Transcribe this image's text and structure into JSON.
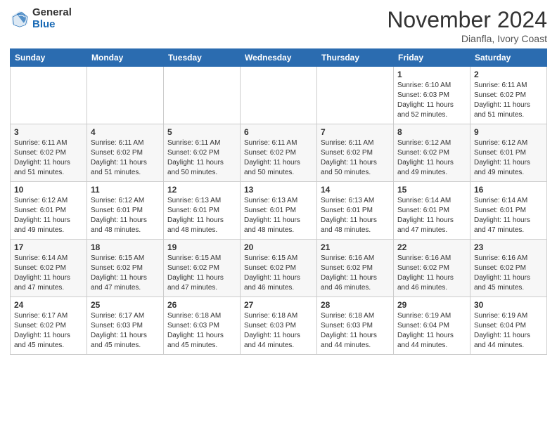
{
  "logo": {
    "general": "General",
    "blue": "Blue"
  },
  "header": {
    "month": "November 2024",
    "location": "Dianfla, Ivory Coast"
  },
  "weekdays": [
    "Sunday",
    "Monday",
    "Tuesday",
    "Wednesday",
    "Thursday",
    "Friday",
    "Saturday"
  ],
  "weeks": [
    [
      {
        "day": "",
        "info": ""
      },
      {
        "day": "",
        "info": ""
      },
      {
        "day": "",
        "info": ""
      },
      {
        "day": "",
        "info": ""
      },
      {
        "day": "",
        "info": ""
      },
      {
        "day": "1",
        "info": "Sunrise: 6:10 AM\nSunset: 6:03 PM\nDaylight: 11 hours and 52 minutes."
      },
      {
        "day": "2",
        "info": "Sunrise: 6:11 AM\nSunset: 6:02 PM\nDaylight: 11 hours and 51 minutes."
      }
    ],
    [
      {
        "day": "3",
        "info": "Sunrise: 6:11 AM\nSunset: 6:02 PM\nDaylight: 11 hours and 51 minutes."
      },
      {
        "day": "4",
        "info": "Sunrise: 6:11 AM\nSunset: 6:02 PM\nDaylight: 11 hours and 51 minutes."
      },
      {
        "day": "5",
        "info": "Sunrise: 6:11 AM\nSunset: 6:02 PM\nDaylight: 11 hours and 50 minutes."
      },
      {
        "day": "6",
        "info": "Sunrise: 6:11 AM\nSunset: 6:02 PM\nDaylight: 11 hours and 50 minutes."
      },
      {
        "day": "7",
        "info": "Sunrise: 6:11 AM\nSunset: 6:02 PM\nDaylight: 11 hours and 50 minutes."
      },
      {
        "day": "8",
        "info": "Sunrise: 6:12 AM\nSunset: 6:02 PM\nDaylight: 11 hours and 49 minutes."
      },
      {
        "day": "9",
        "info": "Sunrise: 6:12 AM\nSunset: 6:01 PM\nDaylight: 11 hours and 49 minutes."
      }
    ],
    [
      {
        "day": "10",
        "info": "Sunrise: 6:12 AM\nSunset: 6:01 PM\nDaylight: 11 hours and 49 minutes."
      },
      {
        "day": "11",
        "info": "Sunrise: 6:12 AM\nSunset: 6:01 PM\nDaylight: 11 hours and 48 minutes."
      },
      {
        "day": "12",
        "info": "Sunrise: 6:13 AM\nSunset: 6:01 PM\nDaylight: 11 hours and 48 minutes."
      },
      {
        "day": "13",
        "info": "Sunrise: 6:13 AM\nSunset: 6:01 PM\nDaylight: 11 hours and 48 minutes."
      },
      {
        "day": "14",
        "info": "Sunrise: 6:13 AM\nSunset: 6:01 PM\nDaylight: 11 hours and 48 minutes."
      },
      {
        "day": "15",
        "info": "Sunrise: 6:14 AM\nSunset: 6:01 PM\nDaylight: 11 hours and 47 minutes."
      },
      {
        "day": "16",
        "info": "Sunrise: 6:14 AM\nSunset: 6:01 PM\nDaylight: 11 hours and 47 minutes."
      }
    ],
    [
      {
        "day": "17",
        "info": "Sunrise: 6:14 AM\nSunset: 6:02 PM\nDaylight: 11 hours and 47 minutes."
      },
      {
        "day": "18",
        "info": "Sunrise: 6:15 AM\nSunset: 6:02 PM\nDaylight: 11 hours and 47 minutes."
      },
      {
        "day": "19",
        "info": "Sunrise: 6:15 AM\nSunset: 6:02 PM\nDaylight: 11 hours and 47 minutes."
      },
      {
        "day": "20",
        "info": "Sunrise: 6:15 AM\nSunset: 6:02 PM\nDaylight: 11 hours and 46 minutes."
      },
      {
        "day": "21",
        "info": "Sunrise: 6:16 AM\nSunset: 6:02 PM\nDaylight: 11 hours and 46 minutes."
      },
      {
        "day": "22",
        "info": "Sunrise: 6:16 AM\nSunset: 6:02 PM\nDaylight: 11 hours and 46 minutes."
      },
      {
        "day": "23",
        "info": "Sunrise: 6:16 AM\nSunset: 6:02 PM\nDaylight: 11 hours and 45 minutes."
      }
    ],
    [
      {
        "day": "24",
        "info": "Sunrise: 6:17 AM\nSunset: 6:02 PM\nDaylight: 11 hours and 45 minutes."
      },
      {
        "day": "25",
        "info": "Sunrise: 6:17 AM\nSunset: 6:03 PM\nDaylight: 11 hours and 45 minutes."
      },
      {
        "day": "26",
        "info": "Sunrise: 6:18 AM\nSunset: 6:03 PM\nDaylight: 11 hours and 45 minutes."
      },
      {
        "day": "27",
        "info": "Sunrise: 6:18 AM\nSunset: 6:03 PM\nDaylight: 11 hours and 44 minutes."
      },
      {
        "day": "28",
        "info": "Sunrise: 6:18 AM\nSunset: 6:03 PM\nDaylight: 11 hours and 44 minutes."
      },
      {
        "day": "29",
        "info": "Sunrise: 6:19 AM\nSunset: 6:04 PM\nDaylight: 11 hours and 44 minutes."
      },
      {
        "day": "30",
        "info": "Sunrise: 6:19 AM\nSunset: 6:04 PM\nDaylight: 11 hours and 44 minutes."
      }
    ]
  ]
}
